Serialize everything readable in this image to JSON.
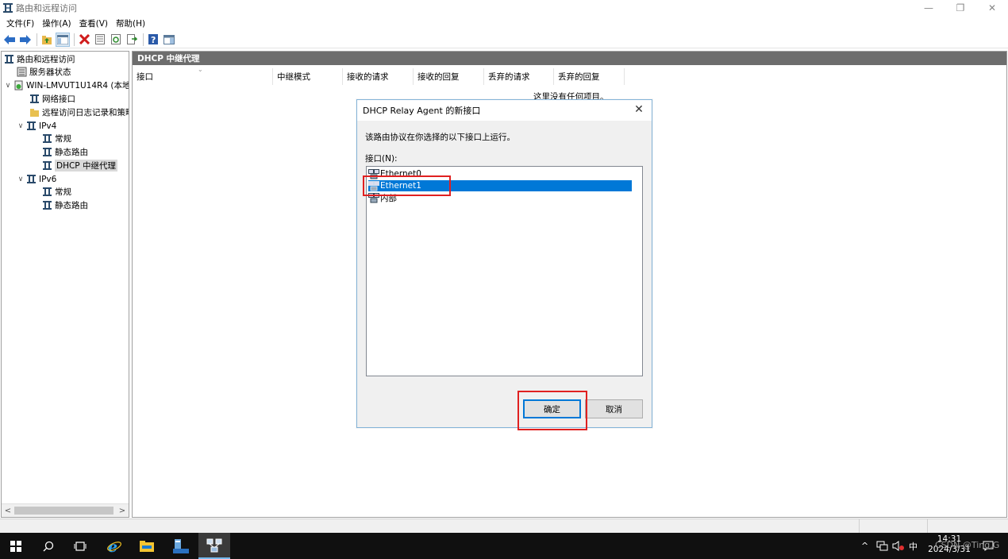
{
  "window": {
    "title": "路由和远程访问"
  },
  "menubar": {
    "items": [
      "文件(F)",
      "操作(A)",
      "查看(V)",
      "帮助(H)"
    ]
  },
  "tree": {
    "root": "路由和远程访问",
    "server_status": "服务器状态",
    "server": "WIN-LMVUT1U14R4 (本地",
    "network_interfaces": "网络接口",
    "remote_log": "远程访问日志记录和策略",
    "ipv4": "IPv4",
    "ipv4_general": "常规",
    "ipv4_static_routes": "静态路由",
    "ipv4_dhcp_relay": "DHCP 中继代理",
    "ipv6": "IPv6",
    "ipv6_general": "常规",
    "ipv6_static_routes": "静态路由"
  },
  "content": {
    "header": "DHCP 中继代理",
    "columns": [
      "接口",
      "中继模式",
      "接收的请求",
      "接收的回复",
      "丢弃的请求",
      "丢弃的回复"
    ],
    "empty_message": "这里没有任何项目。"
  },
  "dialog": {
    "title": "DHCP Relay Agent 的新接口",
    "description": "该路由协议在你选择的以下接口上运行。",
    "list_label": "接口(N):",
    "interfaces": [
      "Ethernet0",
      "Ethernet1",
      "内部"
    ],
    "selected_index": 1,
    "ok_label": "确定",
    "cancel_label": "取消"
  },
  "taskbar": {
    "clock_time": "14:31",
    "clock_date": "2024/3/31",
    "ime": "中"
  },
  "watermark": "CSDN @Ting.G"
}
